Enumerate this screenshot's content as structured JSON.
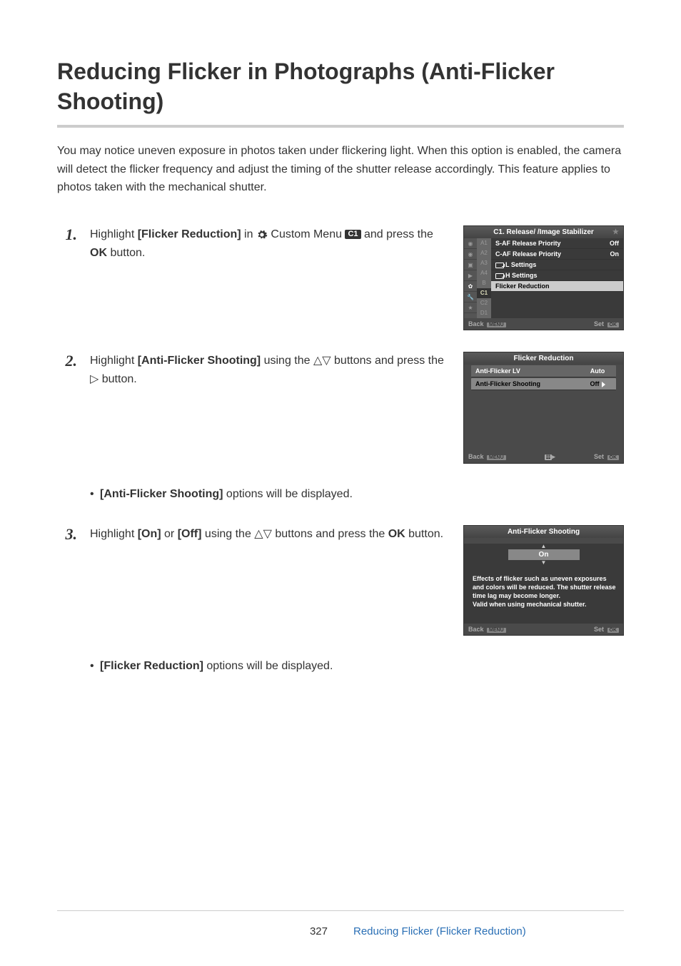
{
  "title": "Reducing Flicker in Photographs (Anti-Flicker Shooting)",
  "intro": "You may notice uneven exposure in photos taken under flickering light. When this option is enabled, the camera will detect the flicker frequency and adjust the timing of the shutter release accordingly. This feature applies to photos taken with the mechanical shutter.",
  "step1": {
    "pre": "Highlight ",
    "bold1": "[Flicker Reduction]",
    "mid": " in ",
    "c1": "C1",
    "post": " Custom Menu ",
    "tail": " and press the ",
    "ok": "OK",
    "tail2": " button."
  },
  "screen1": {
    "header": "C1. Release/    /Image Stabilizer",
    "rows": [
      {
        "label": "S-AF Release Priority",
        "val": "Off"
      },
      {
        "label": "C-AF Release Priority",
        "val": "On"
      },
      {
        "label": "L Settings",
        "val": ""
      },
      {
        "label": "H Settings",
        "val": ""
      },
      {
        "label": "Flicker Reduction",
        "val": "",
        "hilite": true
      }
    ],
    "tabs": [
      "A1",
      "A2",
      "A3",
      "A4",
      "B",
      "C1",
      "C2",
      "D1"
    ],
    "back": "Back",
    "menu": "MENU",
    "set": "Set",
    "ok": "OK"
  },
  "step2": {
    "pre": "Highlight ",
    "bold1": "[Anti-Flicker Shooting]",
    "mid": " using the ",
    "post": " buttons and press the ",
    "tail": " button."
  },
  "screen2": {
    "header": "Flicker Reduction",
    "rows": [
      {
        "label": "Anti-Flicker LV",
        "val": "Auto"
      },
      {
        "label": "Anti-Flicker Shooting",
        "val": "Off",
        "sel": true
      }
    ],
    "back": "Back",
    "menu": "MENU",
    "set": "Set",
    "ok": "OK"
  },
  "bullet2": "[Anti-Flicker Shooting]",
  "bullet2_tail": " options will be displayed.",
  "step3": {
    "pre": "Highlight ",
    "bold1": "[On]",
    "mid": " or ",
    "bold2": "[Off]",
    "mid2": " using the ",
    "post": " buttons and press the ",
    "ok": "OK",
    "tail": " button."
  },
  "screen3": {
    "header": "Anti-Flicker Shooting",
    "value": "On",
    "desc": "Effects of flicker such as uneven exposures and colors will be reduced. The shutter release time lag may become longer.\nValid when using mechanical shutter.",
    "back": "Back",
    "menu": "MENU",
    "set": "Set",
    "ok": "OK"
  },
  "bullet3": "[Flicker Reduction]",
  "bullet3_tail": " options will be displayed.",
  "footer": {
    "page": "327",
    "link": "Reducing Flicker (Flicker Reduction)"
  }
}
